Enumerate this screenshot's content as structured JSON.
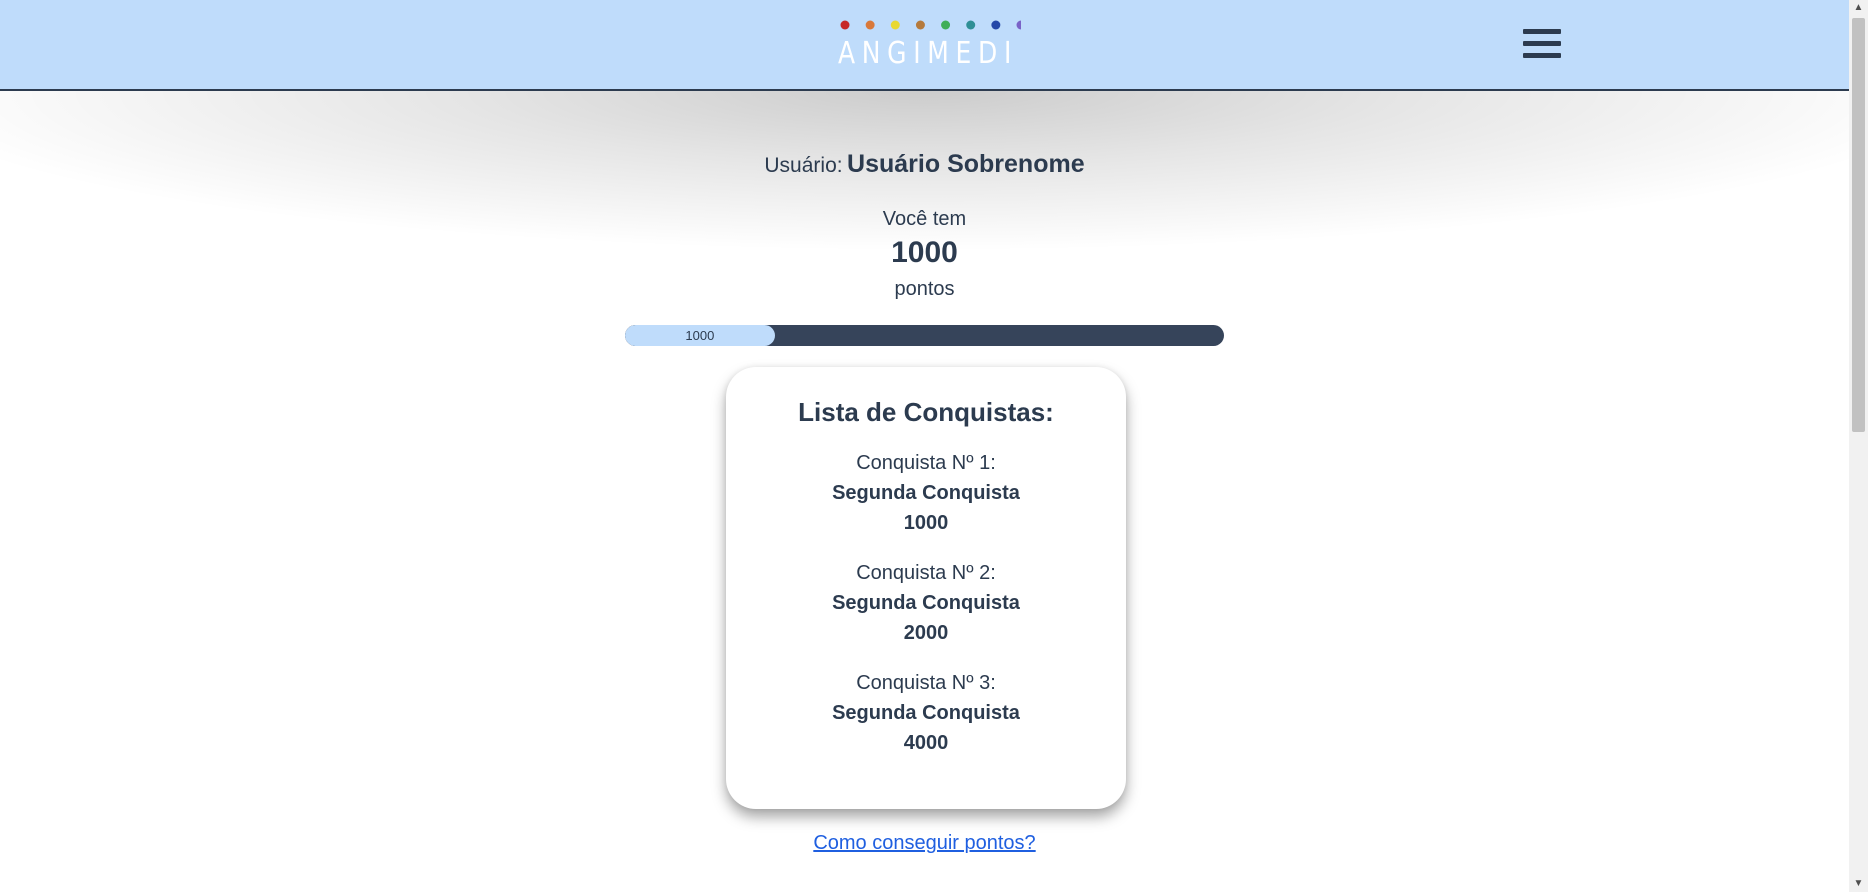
{
  "header": {
    "logo_text": "ANGIMEDI",
    "logo_dot_colors": [
      "#c62828",
      "#d9793a",
      "#e8d832",
      "#b57a3c",
      "#3fae58",
      "#2f8f95",
      "#2548a8",
      "#7a63c7"
    ],
    "menu_icon": "hamburger-menu-icon",
    "background_color": "#bfdcfb"
  },
  "user": {
    "label": "Usuário:",
    "name": "Usuário Sobrenome"
  },
  "points": {
    "prefix": "Você tem",
    "value": "1000",
    "suffix": "pontos"
  },
  "progress": {
    "label": "1000",
    "fill_fraction": 0.25
  },
  "achievements": {
    "title": "Lista de Conquistas:",
    "items": [
      {
        "label": "Conquista Nº 1:",
        "name": "Segunda Conquista",
        "points": "1000"
      },
      {
        "label": "Conquista Nº 2:",
        "name": "Segunda Conquista",
        "points": "2000"
      },
      {
        "label": "Conquista Nº 3:",
        "name": "Segunda Conquista",
        "points": "4000"
      }
    ]
  },
  "help_link": "Como conseguir pontos?",
  "scrollbar": {
    "up_icon": "scroll-up-arrow-icon",
    "down_icon": "scroll-down-arrow-icon"
  }
}
